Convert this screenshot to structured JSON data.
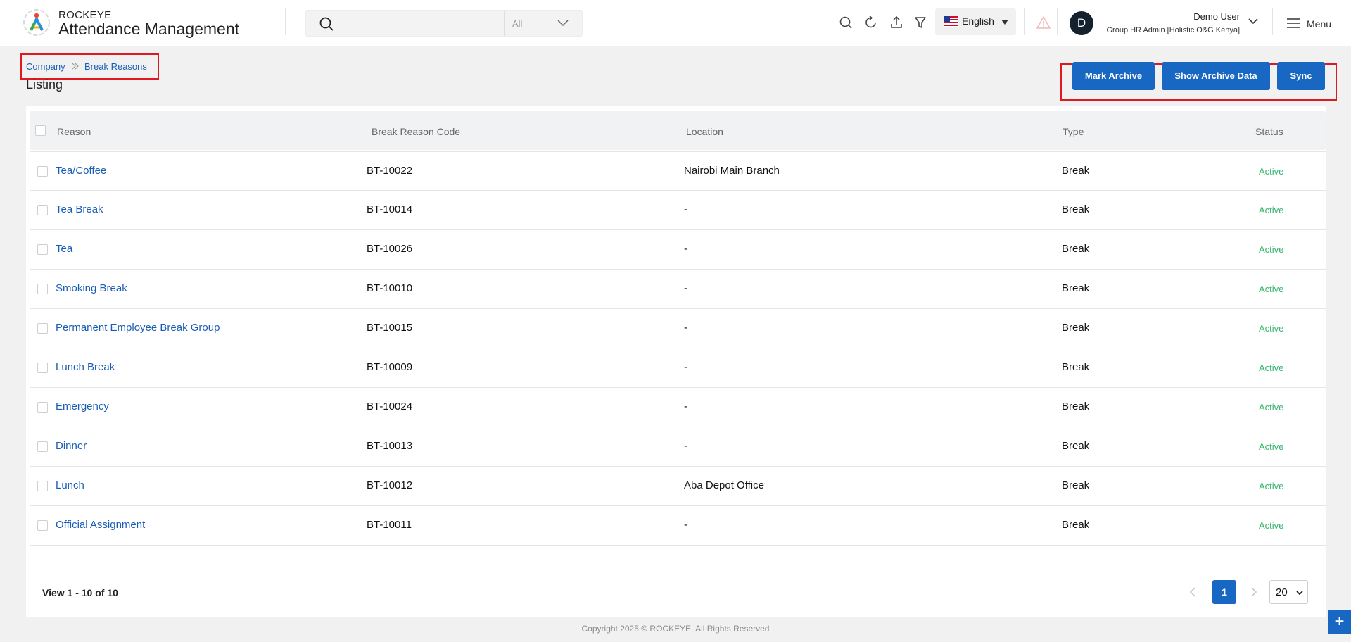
{
  "header": {
    "brand_small": "ROCKEYE",
    "brand_title": "Attendance Management",
    "search": {
      "placeholder": "",
      "filter_label": "All"
    },
    "language": "English",
    "user": {
      "avatar_initial": "D",
      "name": "Demo User",
      "role": "Group HR Admin [Holistic O&G Kenya]"
    },
    "menu_label": "Menu",
    "icons": [
      "search-icon",
      "refresh-icon",
      "upload-icon",
      "filter-icon",
      "warning-icon",
      "chevron-down-icon",
      "hamburger-icon"
    ],
    "colors": {
      "accent": "#1767c3",
      "highlight_border": "#e0181f",
      "status_active": "#34b56a",
      "link": "#1a5db5"
    }
  },
  "breadcrumb": {
    "items": [
      "Company",
      "Break Reasons"
    ]
  },
  "page_title": "Listing",
  "actions": {
    "mark_archive": "Mark Archive",
    "show_archive": "Show Archive Data",
    "sync": "Sync"
  },
  "table": {
    "columns": [
      "Reason",
      "Break Reason Code",
      "Location",
      "Type",
      "Status"
    ],
    "rows": [
      {
        "reason": "Tea/Coffee",
        "code": "BT-10022",
        "location": "Nairobi Main Branch",
        "type": "Break",
        "status": "Active"
      },
      {
        "reason": "Tea Break",
        "code": "BT-10014",
        "location": "-",
        "type": "Break",
        "status": "Active"
      },
      {
        "reason": "Tea",
        "code": "BT-10026",
        "location": "-",
        "type": "Break",
        "status": "Active"
      },
      {
        "reason": "Smoking Break",
        "code": "BT-10010",
        "location": "-",
        "type": "Break",
        "status": "Active"
      },
      {
        "reason": "Permanent Employee Break Group",
        "code": "BT-10015",
        "location": "-",
        "type": "Break",
        "status": "Active"
      },
      {
        "reason": "Lunch Break",
        "code": "BT-10009",
        "location": "-",
        "type": "Break",
        "status": "Active"
      },
      {
        "reason": "Emergency",
        "code": "BT-10024",
        "location": "-",
        "type": "Break",
        "status": "Active"
      },
      {
        "reason": "Dinner",
        "code": "BT-10013",
        "location": "-",
        "type": "Break",
        "status": "Active"
      },
      {
        "reason": "Lunch",
        "code": "BT-10012",
        "location": "Aba Depot Office",
        "type": "Break",
        "status": "Active"
      },
      {
        "reason": "Official Assignment",
        "code": "BT-10011",
        "location": "-",
        "type": "Break",
        "status": "Active"
      }
    ]
  },
  "pagination": {
    "view_text": "View 1 - 10 of 10",
    "current_page": "1",
    "page_size": "20"
  },
  "footer": {
    "copyright": "Copyright 2025 © ROCKEYE. All Rights Reserved"
  },
  "fab_label": "+"
}
